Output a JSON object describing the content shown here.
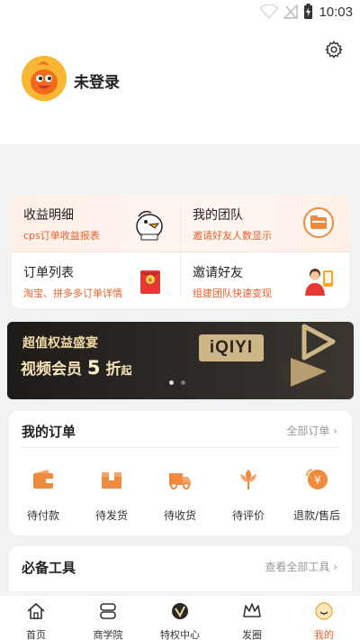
{
  "status_bar": {
    "time": "10:03",
    "icons": [
      "wifi-icon",
      "signal-icon",
      "battery-charging-icon"
    ]
  },
  "header": {
    "login_text": "未登录",
    "icons": [
      "settings-gear-icon",
      "mascot-avatar"
    ]
  },
  "features": [
    {
      "title": "收益明细",
      "subtitle": "cps订单收益报表",
      "icon": "duck-mascot-icon"
    },
    {
      "title": "我的团队",
      "subtitle": "邀请好友人数显示",
      "icon": "folder-circle-icon"
    },
    {
      "title": "订单列表",
      "subtitle": "淘宝、拼多多订单详情",
      "icon": "red-envelope-yen-icon"
    },
    {
      "title": "邀请好友",
      "subtitle": "组建团队快速变现",
      "icon": "person-phone-icon"
    }
  ],
  "banner": {
    "line1": "超值权益盛宴",
    "line2_prefix": "视频会员",
    "line2_number": "5",
    "line2_suffix": "折",
    "line2_tail": "起",
    "logo_text": "iQIYI",
    "pages": 2,
    "current_page": 1
  },
  "orders": {
    "title": "我的订单",
    "more": "全部订单 ›",
    "items": [
      {
        "label": "待付款",
        "icon": "wallet-icon"
      },
      {
        "label": "待发货",
        "icon": "box-icon"
      },
      {
        "label": "待收货",
        "icon": "truck-icon"
      },
      {
        "label": "待评价",
        "icon": "flower-icon"
      },
      {
        "label": "退款/售后",
        "icon": "refund-yen-icon"
      }
    ]
  },
  "tools": {
    "title": "必备工具",
    "more": "查看全部工具 ›"
  },
  "nav": [
    {
      "label": "首页",
      "icon": "home-icon"
    },
    {
      "label": "商学院",
      "icon": "school-icon"
    },
    {
      "label": "特权中心",
      "icon": "vip-badge-icon"
    },
    {
      "label": "发圈",
      "icon": "crown-icon"
    },
    {
      "label": "我的",
      "icon": "smile-face-icon",
      "active": true
    }
  ],
  "colors": {
    "accent": "#e8602c",
    "avatar": "#f5a623",
    "banner_bg": "#2b2724",
    "banner_text": "#f0d9a6"
  }
}
